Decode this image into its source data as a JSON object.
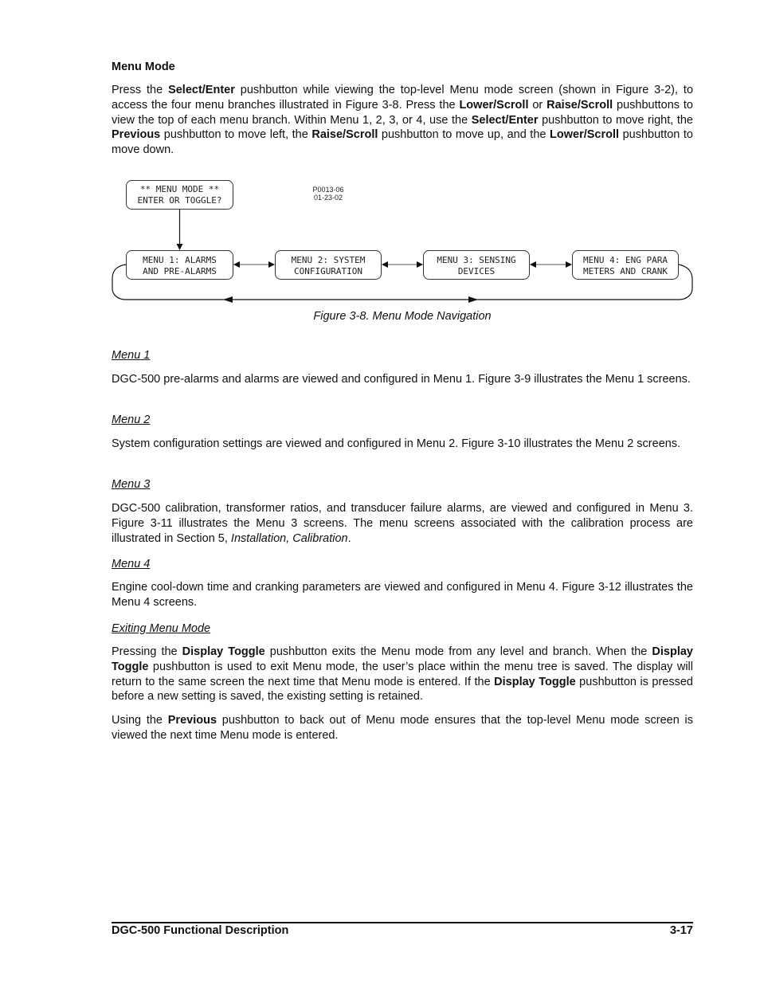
{
  "section_title": "Menu Mode",
  "intro": {
    "segments": [
      {
        "t": "Press the ",
        "b": false
      },
      {
        "t": "Select/Enter",
        "b": true
      },
      {
        "t": " pushbutton while viewing the top-level Menu mode screen (shown in Figure 3-2), to access the four menu branches illustrated in Figure 3-8. Press the ",
        "b": false
      },
      {
        "t": "Lower/Scroll",
        "b": true
      },
      {
        "t": " or ",
        "b": false
      },
      {
        "t": "Raise/Scroll",
        "b": true
      },
      {
        "t": " pushbuttons to view the top of each menu branch. Within Menu 1, 2, 3, or 4, use the  ",
        "b": false
      },
      {
        "t": "Select/Enter",
        "b": true
      },
      {
        "t": " pushbutton to move right, the ",
        "b": false
      },
      {
        "t": "Previous",
        "b": true
      },
      {
        "t": " pushbutton to move left, the ",
        "b": false
      },
      {
        "t": "Raise/Scroll",
        "b": true
      },
      {
        "t": " pushbutton to move up, and the ",
        "b": false
      },
      {
        "t": "Lower/Scroll",
        "b": true
      },
      {
        "t": " pushbutton to move down.",
        "b": false
      }
    ]
  },
  "figure": {
    "top_box": [
      "** MENU MODE **",
      "ENTER OR TOGGLE?"
    ],
    "drawing_code": [
      "P0013-06",
      "01-23-02"
    ],
    "menu_boxes": [
      [
        "MENU 1: ALARMS",
        "AND PRE-ALARMS"
      ],
      [
        "MENU 2: SYSTEM",
        "CONFIGURATION"
      ],
      [
        "MENU 3: SENSING",
        "DEVICES"
      ],
      [
        "MENU 4: ENG PARA",
        "METERS AND CRANK"
      ]
    ],
    "caption": "Figure 3-8. Menu Mode Navigation"
  },
  "sections": [
    {
      "heading": "Menu 1",
      "body": [
        {
          "t": "DGC-500 pre-alarms and alarms are viewed and configured in Menu 1. Figure 3-9 illustrates the Menu 1 screens.",
          "b": false
        }
      ]
    },
    {
      "heading": "Menu 2",
      "body": [
        {
          "t": "System configuration settings are viewed and configured in Menu 2. Figure 3-10 illustrates the Menu 2 screens.",
          "b": false
        }
      ]
    },
    {
      "heading": "Menu 3",
      "body": [
        {
          "t": "DGC-500 calibration, transformer ratios, and transducer failure alarms, are viewed and configured in Menu 3. Figure 3-11 illustrates the Menu 3 screens. The menu screens associated with the calibration process are illustrated in Section 5, ",
          "b": false
        },
        {
          "t": "Installation, Calibration",
          "i": true
        },
        {
          "t": ".",
          "b": false
        }
      ]
    },
    {
      "heading": "Menu 4",
      "body": [
        {
          "t": "Engine cool-down time and cranking parameters are viewed and configured in Menu 4. Figure 3-12 illustrates the Menu 4 screens.",
          "b": false
        }
      ]
    },
    {
      "heading": "Exiting Menu Mode",
      "body": [
        {
          "t": "Pressing the ",
          "b": false
        },
        {
          "t": "Display Toggle",
          "b": true
        },
        {
          "t": " pushbutton exits the Menu mode from any level and branch. When the ",
          "b": false
        },
        {
          "t": "Display Toggle",
          "b": true
        },
        {
          "t": " pushbutton is used to exit Menu mode, the user’s place within the menu tree is saved. The display will return to the same screen the next time that Menu mode is entered. If the ",
          "b": false
        },
        {
          "t": "Display Toggle",
          "b": true
        },
        {
          "t": " pushbutton is pressed before a new setting is saved, the existing setting is retained.",
          "b": false
        }
      ]
    }
  ],
  "closing": [
    {
      "t": "Using the ",
      "b": false
    },
    {
      "t": "Previous",
      "b": true
    },
    {
      "t": " pushbutton to back out of Menu mode ensures that the top-level Menu mode screen is viewed the next time Menu mode is entered.",
      "b": false
    }
  ],
  "footer": {
    "left": "DGC-500 Functional Description",
    "right": "3-17"
  }
}
